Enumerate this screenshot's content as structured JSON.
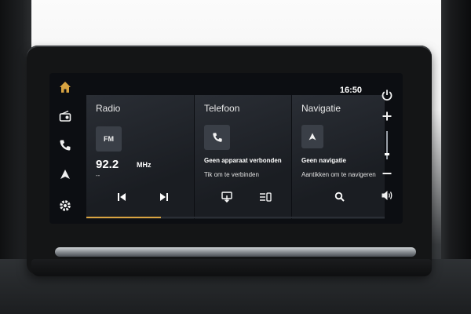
{
  "status": {
    "clock": "16:50"
  },
  "sidebar_left": {
    "icons": [
      "home-icon",
      "radio-icon",
      "phone-icon",
      "navigation-icon",
      "settings-icon"
    ],
    "active_color": "#d9a441"
  },
  "sidebar_right": {
    "icons": [
      "power-icon",
      "plus-icon",
      "minus-icon",
      "speaker-icon"
    ],
    "volume_level": 0.2
  },
  "radio": {
    "title": "Radio",
    "band": "FM",
    "frequency": "92.2",
    "unit": "MHz",
    "station": "--"
  },
  "phone": {
    "title": "Telefoon",
    "status": "Geen apparaat verbonden",
    "hint": "Tik om te verbinden"
  },
  "navigation": {
    "title": "Navigatie",
    "status": "Geen navigatie",
    "hint": "Aantikken om te navigeren"
  },
  "playback_progress": 0.25,
  "colors": {
    "accent": "#d9a441",
    "panel": "#23272d",
    "screen": "#0c0e12"
  }
}
